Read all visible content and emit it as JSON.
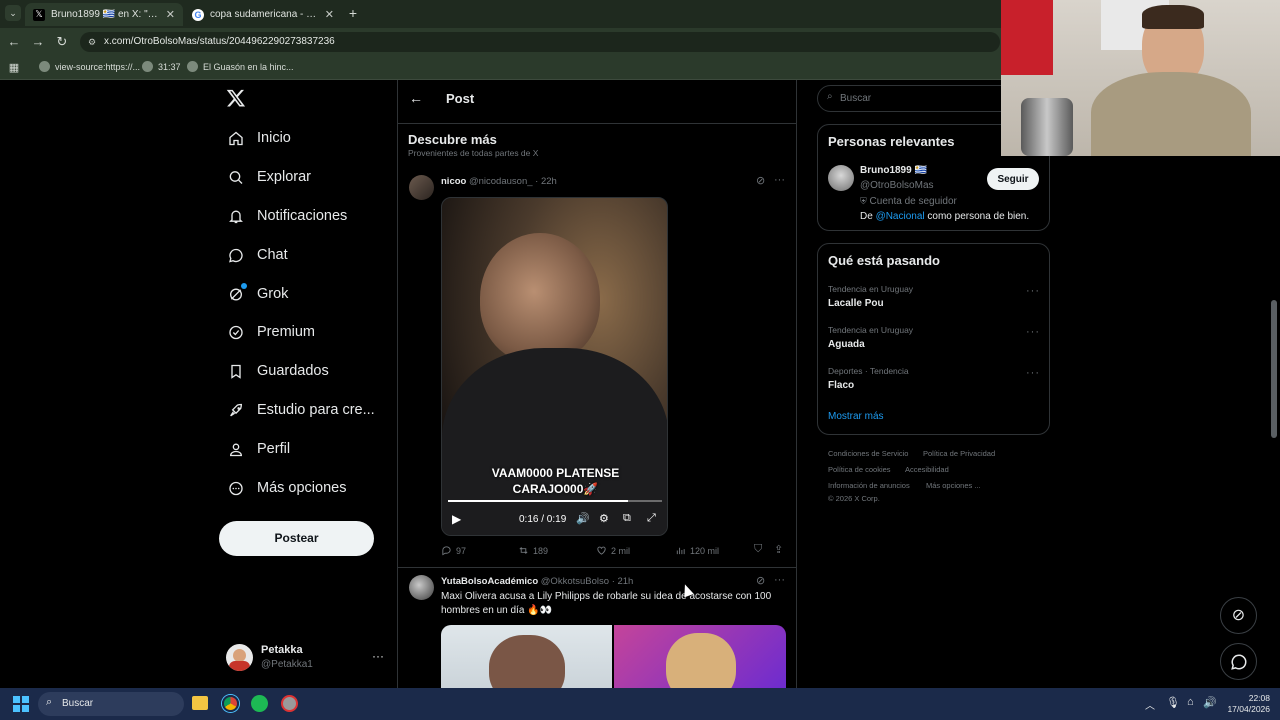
{
  "browser": {
    "tabs": [
      {
        "title": "Bruno1899 🇺🇾 en X: \"Desde este",
        "icon": "x-logo-icon"
      },
      {
        "title": "copa sudamericana - Buscar co",
        "icon": "google-icon"
      }
    ],
    "url": "x.com/OtroBolsoMas/status/2044962290273837236",
    "bookmarks": [
      "view-source:https://...",
      "31:37",
      "El Guasón en la hinc..."
    ]
  },
  "nav": {
    "items": [
      "Inicio",
      "Explorar",
      "Notificaciones",
      "Chat",
      "Grok",
      "Premium",
      "Guardados",
      "Estudio para cre...",
      "Perfil",
      "Más opciones"
    ],
    "post_label": "Postear",
    "user_name": "Petakka",
    "user_handle": "@Petakka1"
  },
  "header": {
    "title": "Post"
  },
  "discover": {
    "title": "Descubre más",
    "subtitle": "Provenientes de todas partes de X"
  },
  "tweet1": {
    "name": "nicoo",
    "handle": "@nicodauson_",
    "time": "· 22h",
    "caption": "VAAM0000 PLATENSE CARAJO000🚀",
    "caption_line1": "VAAM0000 PLATENSE",
    "caption_line2": "CARAJO000🚀",
    "video_time": "0:16 / 0:19",
    "video_progress": 0.84,
    "replies": "97",
    "retweets": "189",
    "likes": "2 mil",
    "views": "120 mil"
  },
  "tweet2": {
    "name": "YutaBolsoAcadémico",
    "handle": "@OkkotsuBolso",
    "time": "· 21h",
    "text": "Maxi Olivera acusa a Lily Philipps de robarle su idea de acostarse con 100 hombres en un día 🔥👀"
  },
  "search": {
    "placeholder": "Buscar"
  },
  "relevant": {
    "title": "Personas relevantes",
    "name": "Bruno1899 🇺🇾",
    "handle": "@OtroBolsoMas",
    "follow_label": "Seguir",
    "follower_note": "Cuenta de seguidor",
    "bio_prefix": "De ",
    "bio_mention": "@Nacional",
    "bio_suffix": " como persona de bien."
  },
  "trends": {
    "title": "Qué está pasando",
    "items": [
      {
        "category": "Tendencia en Uruguay",
        "name": "Lacalle Pou"
      },
      {
        "category": "Tendencia en Uruguay",
        "name": "Aguada"
      },
      {
        "category": "Deportes · Tendencia",
        "name": "Flaco"
      }
    ],
    "show_more": "Mostrar más"
  },
  "footer": {
    "links": [
      "Condiciones de Servicio",
      "Política de Privacidad",
      "Política de cookies",
      "Accesibilidad",
      "Información de anuncios",
      "Más opciones ..."
    ],
    "copyright": "© 2026 X Corp."
  },
  "taskbar": {
    "search": "Buscar",
    "time": "22:08",
    "date": "17/04/2026"
  },
  "colors": {
    "accent": "#1d9bf0",
    "bg": "#000000",
    "border": "#2f3336",
    "muted": "#71767b"
  }
}
